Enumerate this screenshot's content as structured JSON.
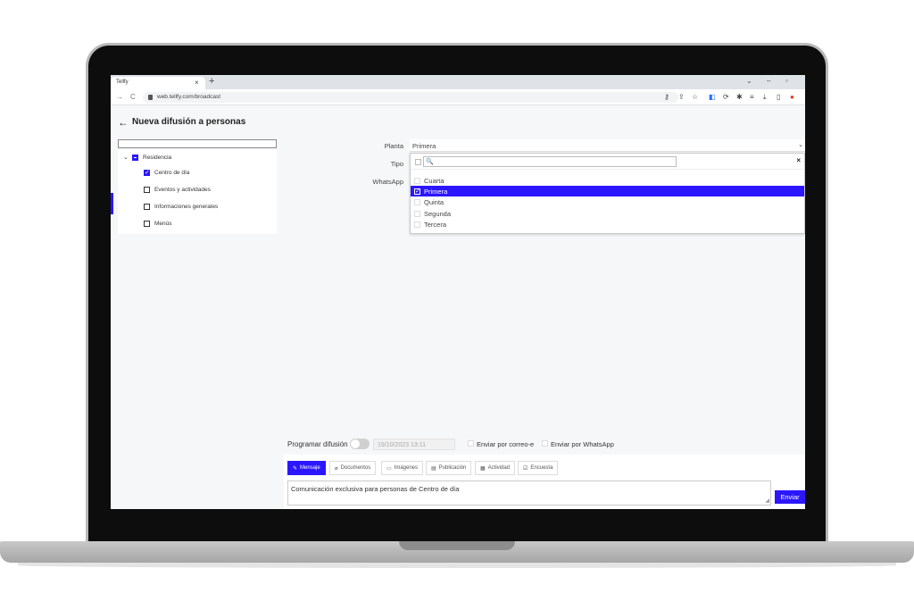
{
  "browser": {
    "tab_title": "Tellfy",
    "tab_close": "×",
    "new_tab": "+",
    "url": "web.tellfy.com/broadcast",
    "window_controls": {
      "minimize": "–",
      "maximize": "▫",
      "dropdown": "⌄"
    },
    "toolbar_icons": [
      "key-icon",
      "share-icon",
      "star-icon",
      "extension-icon",
      "puzzle-icon",
      "download-icon",
      "sidepanel-icon",
      "profile-icon"
    ]
  },
  "page": {
    "back": "←",
    "title": "Nueva difusión a personas"
  },
  "tree": {
    "root": {
      "chevron": "⌄",
      "label": "Residencia",
      "state": "indeterminate"
    },
    "children": [
      {
        "label": "Centro de día",
        "checked": true
      },
      {
        "label": "Eventos y actividades",
        "checked": false
      },
      {
        "label": "Informaciones generales",
        "checked": false
      },
      {
        "label": "Menús",
        "checked": false
      }
    ]
  },
  "filters": {
    "planta_label": "Planta",
    "tipo_label": "Tipo",
    "whatsapp_label": "WhatsApp",
    "planta_value": "Primera",
    "caret": "⌄"
  },
  "dropdown": {
    "search_icon": "🔍",
    "close": "×",
    "options": [
      {
        "label": "Cuarta",
        "selected": false
      },
      {
        "label": "Primera",
        "selected": true
      },
      {
        "label": "Quinta",
        "selected": false
      },
      {
        "label": "Segunda",
        "selected": false
      },
      {
        "label": "Tercera",
        "selected": false
      }
    ]
  },
  "schedule": {
    "label": "Programar difusión",
    "date_placeholder": "19/10/2023 13:11",
    "email_label": "Enviar por correo-e",
    "whatsapp_label": "Enviar por WhatsApp"
  },
  "composer": {
    "tabs": [
      {
        "label": "Mensaje",
        "icon": "✎",
        "active": true
      },
      {
        "label": "Documentos",
        "icon": "⌀",
        "active": false
      },
      {
        "label": "Imágenes",
        "icon": "▭",
        "active": false
      },
      {
        "label": "Publicación",
        "icon": "▤",
        "active": false
      },
      {
        "label": "Actividad",
        "icon": "▦",
        "active": false
      },
      {
        "label": "Encuesta",
        "icon": "☑",
        "active": false
      }
    ],
    "message": "Comunicación exclusiva para personas de Centro de día",
    "send_label": "Enviar"
  },
  "colors": {
    "accent": "#2b16ff",
    "background": "#f6f7f9"
  }
}
